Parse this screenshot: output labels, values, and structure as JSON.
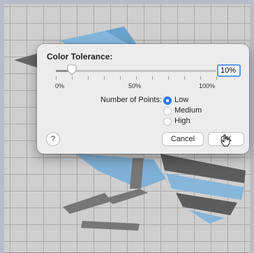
{
  "dialog": {
    "title": "Color Tolerance:",
    "tolerance_value": "10%",
    "slider_level_percent": 10,
    "ticks": {
      "min_label": "0%",
      "mid_label": "50%",
      "max_label": "100%"
    },
    "points_label": "Number of Points:",
    "options": [
      {
        "label": "Low",
        "selected": true
      },
      {
        "label": "Medium",
        "selected": false
      },
      {
        "label": "High",
        "selected": false
      }
    ],
    "help_label": "?",
    "cancel_label": "Cancel",
    "ok_label": "OK"
  },
  "colors": {
    "accent": "#2f7bf5",
    "focus_ring": "#5a9ae6",
    "dialog_bg": "#ececec",
    "canvas_bg": "#cfcfcf"
  },
  "icons": [
    "bird-artwork",
    "mouse-cursor-icon"
  ]
}
